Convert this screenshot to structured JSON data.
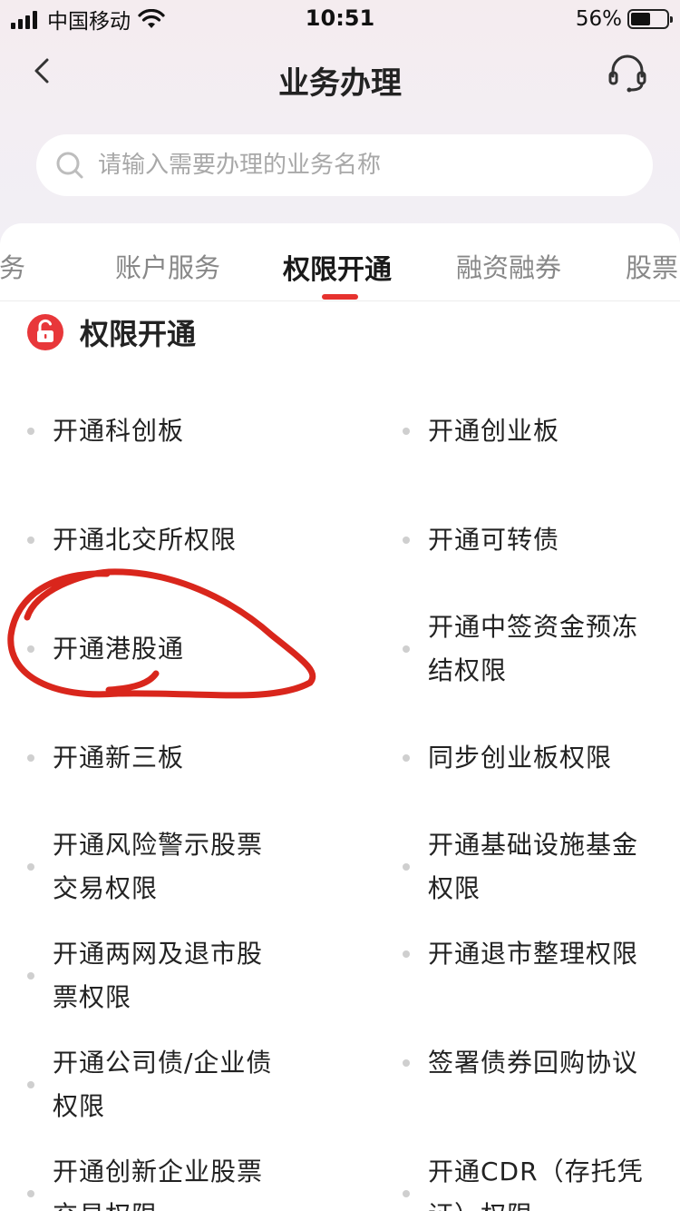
{
  "status_bar": {
    "carrier": "中国移动",
    "time": "10:51",
    "battery": "56%",
    "battery_level": 0.56
  },
  "nav": {
    "title": "业务办理"
  },
  "search": {
    "placeholder": "请输入需要办理的业务名称"
  },
  "tabs": [
    {
      "label": "服务",
      "active": false
    },
    {
      "label": "账户服务",
      "active": false
    },
    {
      "label": "权限开通",
      "active": true
    },
    {
      "label": "融资融券",
      "active": false
    },
    {
      "label": "股票",
      "active": false
    }
  ],
  "section": {
    "title": "权限开通"
  },
  "items": [
    "开通科创板",
    "开通创业板",
    "开通北交所权限",
    "开通可转债",
    "开通港股通",
    "开通中签资金预冻结权限",
    "开通新三板",
    "同步创业板权限",
    "开通风险警示股票交易权限",
    "开通基础设施基金权限",
    "开通两网及退市股票权限",
    "开通退市整理权限",
    "开通公司债/企业债权限",
    "签署债券回购协议",
    "开通创新企业股票交易权限",
    "开通CDR（存托凭证）权限"
  ],
  "colors": {
    "accent": "#e6322e",
    "annotation": "#d9261c"
  }
}
